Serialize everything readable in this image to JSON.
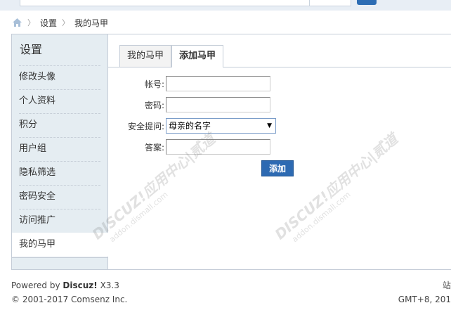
{
  "breadcrumb": {
    "items": [
      "设置",
      "我的马甲"
    ]
  },
  "sidebar": {
    "title": "设置",
    "items": [
      {
        "label": "修改头像"
      },
      {
        "label": "个人资料"
      },
      {
        "label": "积分"
      },
      {
        "label": "用户组"
      },
      {
        "label": "隐私筛选"
      },
      {
        "label": "密码安全"
      },
      {
        "label": "访问推广"
      },
      {
        "label": "我的马甲",
        "active": true
      }
    ]
  },
  "tabs": [
    "我的马甲",
    "添加马甲"
  ],
  "form": {
    "account_label": "帐号:",
    "account_value": "",
    "password_label": "密码:",
    "password_value": "",
    "question_label": "安全提问:",
    "question_selected": "母亲的名字",
    "answer_label": "答案:",
    "answer_value": "",
    "submit_label": "添加"
  },
  "watermark": {
    "brand": "DISCUZ!应用中心|贰道",
    "site": "addon.dismall.com"
  },
  "footer": {
    "powered_prefix": "Powered by",
    "powered_brand": "Discuz!",
    "version": "X3.3",
    "copyright": "© 2001-2017 Comsenz Inc.",
    "right_top": "站",
    "timezone": "GMT+8, 201"
  },
  "colors": {
    "accent": "#2d6ab2",
    "sidebar_bg": "#e5edf2",
    "border": "#c4ccd7"
  }
}
